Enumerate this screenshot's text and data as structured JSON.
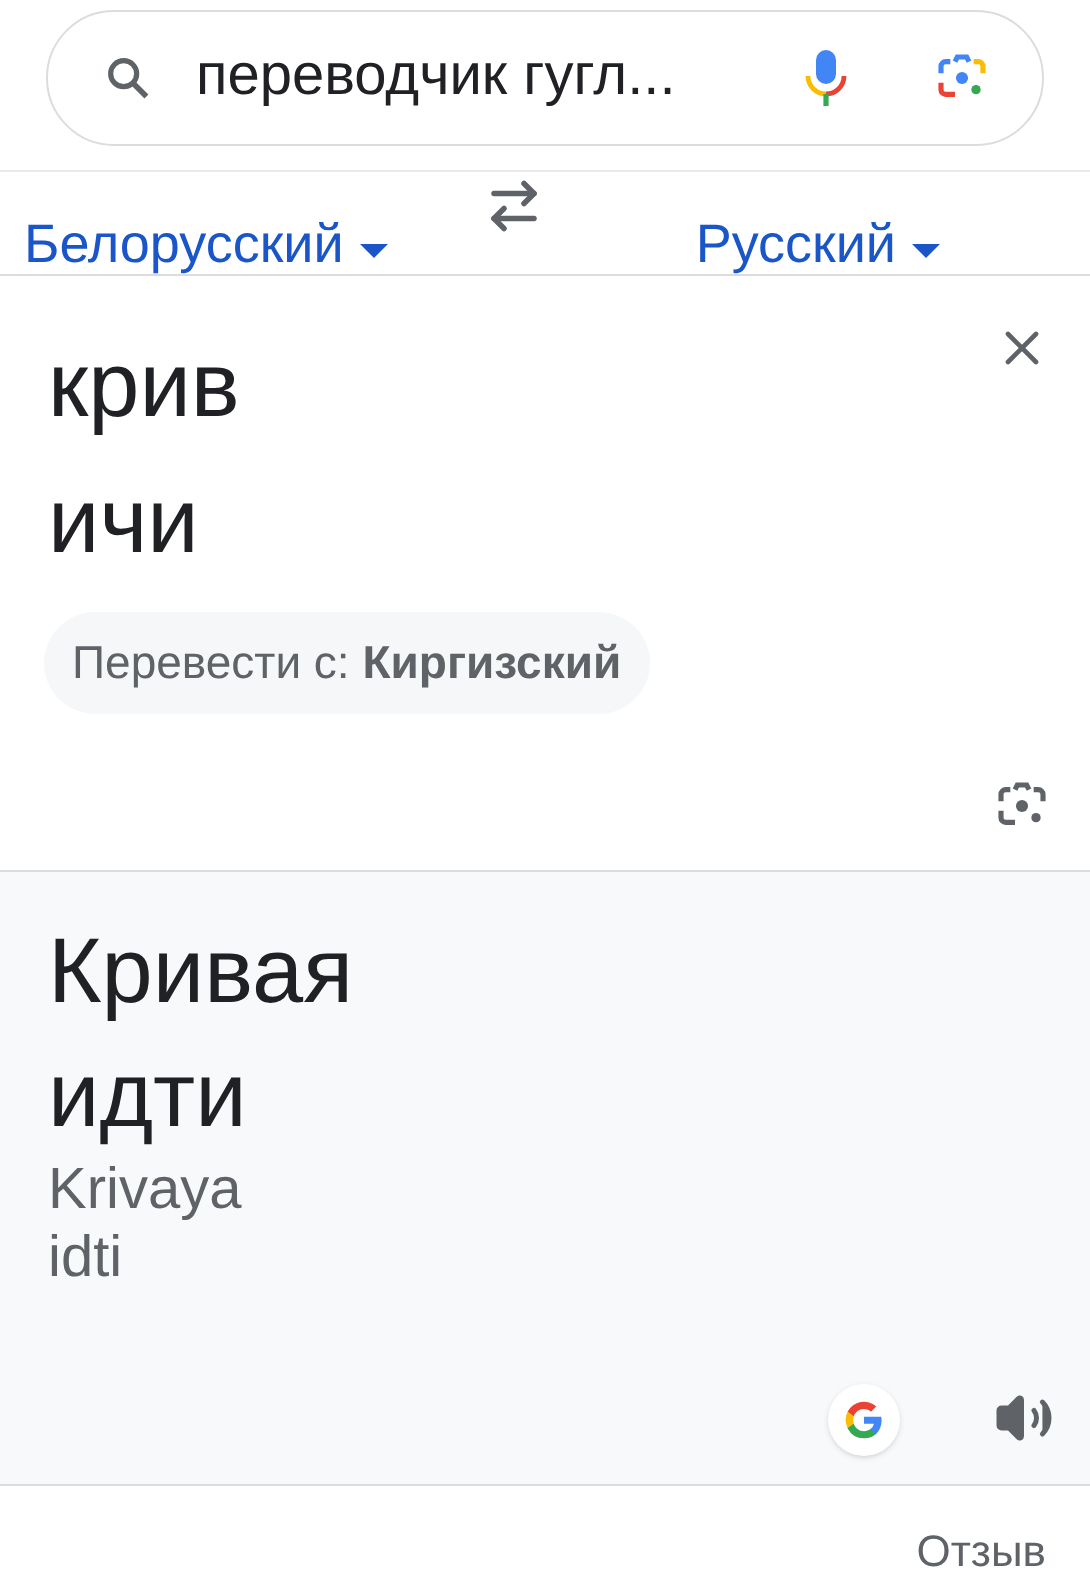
{
  "search": {
    "value": "переводчик гугл..."
  },
  "languages": {
    "source": "Белорусский",
    "target": "Русский"
  },
  "source": {
    "lines": [
      "крив",
      "ичи"
    ],
    "detect_chip": "Перевести с: **Киргизский**"
  },
  "result": {
    "lines": [
      "Кривая",
      "идти"
    ],
    "transliteration": [
      "Krivaya",
      "idti"
    ]
  },
  "footer": {
    "feedback": "Отзыв"
  }
}
